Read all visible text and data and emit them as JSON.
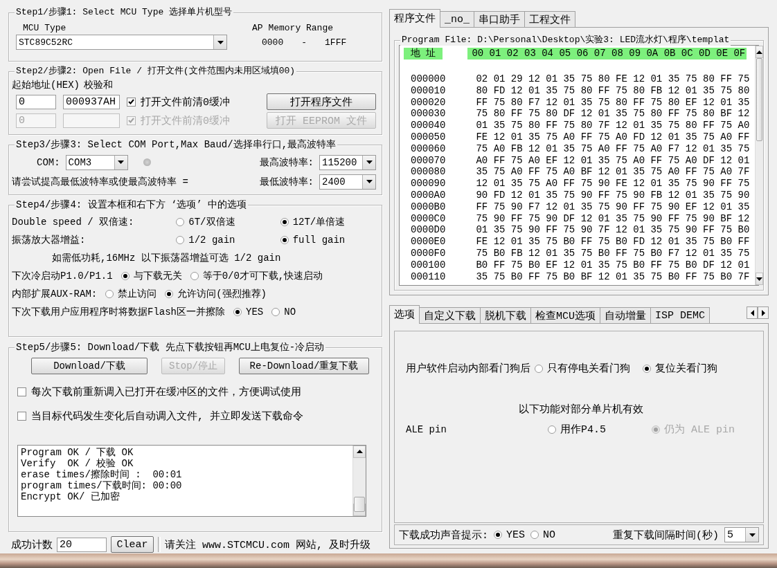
{
  "step1": {
    "legend": "Step1/步骤1: Select MCU Type  选择单片机型号",
    "mcu_label": "MCU Type",
    "mcu_value": "STC89C52RC",
    "range_label": "AP Memory Range",
    "range_start": "0000",
    "range_separator": "-",
    "range_end": "1FFF"
  },
  "step2": {
    "legend": "Step2/步骤2: Open File / 打开文件(文件范围内未用区域填00)",
    "start_label": "起始地址(HEX)",
    "checksum_label": "校验和",
    "rows": [
      {
        "start": "0",
        "checksum": "000937AH",
        "option": "打开文件前清0缓冲",
        "checked": true,
        "disabled": false,
        "button": "打开程序文件"
      },
      {
        "start": "0",
        "option": "打开文件前清0缓冲",
        "checked": true,
        "disabled": true,
        "button": "打开 EEPROM 文件"
      }
    ]
  },
  "step3": {
    "legend": "Step3/步骤3: Select COM Port,Max Baud/选择串行口,最高波特率",
    "com_label": "COM:",
    "com_value": "COM3",
    "max_label": "最高波特率:",
    "max_value": "115200",
    "hint": "请尝试提高最低波特率或使最高波特率 =",
    "min_label": "最低波特率:",
    "min_value": "2400"
  },
  "step4": {
    "legend": "Step4/步骤4: 设置本框和右下方 ‘选项’ 中的选项",
    "rows": [
      {
        "kind": "choice",
        "label": "Double speed / 双倍速:",
        "choices": [
          {
            "label": "6T/双倍速",
            "selected": false
          },
          {
            "label": "12T/单倍速",
            "selected": true
          }
        ]
      },
      {
        "kind": "choice",
        "label": "振荡放大器增益:",
        "choices": [
          {
            "label": "1/2 gain",
            "selected": false
          },
          {
            "label": "full gain",
            "selected": true
          }
        ]
      },
      {
        "kind": "note",
        "text": "如需低功耗,16MHz 以下振荡器增益可选 1/2 gain"
      },
      {
        "kind": "choice",
        "label": "下次冷启动P1.0/P1.1",
        "choices": [
          {
            "label": "与下载无关",
            "selected": true
          },
          {
            "label": "等于0/0才可下载,快速启动",
            "selected": false
          }
        ]
      },
      {
        "kind": "choice",
        "label": "内部扩展AUX-RAM:",
        "choices": [
          {
            "label": "禁止访问",
            "selected": false
          },
          {
            "label": "允许访问(强烈推荐)",
            "selected": true
          }
        ]
      },
      {
        "kind": "choice",
        "label": "下次下载用户应用程序时将数据Flash区一并擦除",
        "choices": [
          {
            "label": "YES",
            "selected": true
          },
          {
            "label": "NO",
            "selected": false
          }
        ]
      }
    ]
  },
  "step5": {
    "legend": "Step5/步骤5: Download/下载  先点下载按钮再MCU上电复位-冷启动",
    "buttons": [
      {
        "label": "Download/下载",
        "disabled": false
      },
      {
        "label": "Stop/停止",
        "disabled": true
      },
      {
        "label": "Re-Download/重复下载",
        "disabled": false
      }
    ],
    "options": [
      {
        "label": "每次下载前重新调入已打开在缓冲区的文件，方便调试使用",
        "checked": false
      },
      {
        "label": "当目标代码发生变化后自动调入文件, 并立即发送下载命令",
        "checked": false
      }
    ],
    "log": [
      "Program OK / 下载 OK",
      "Verify  OK / 校验 OK",
      "erase times/擦除时间 :  00:01",
      "program times/下载时间: 00:00",
      "Encrypt OK/ 已加密"
    ]
  },
  "footer": {
    "count_label": "成功计数",
    "count_value": "20",
    "clear_button": "Clear",
    "notice": "请关注 www.STCMCU.com 网站, 及时升级"
  },
  "top_tabs": [
    {
      "label": "程序文件",
      "selected": true
    },
    {
      "label": "_no_",
      "selected": false
    },
    {
      "label": "串口助手",
      "selected": false
    },
    {
      "label": "工程文件",
      "selected": false
    }
  ],
  "program_file": "Program File: D:\\Personal\\Desktop\\实验3: LED流水灯\\程序\\templat",
  "hex": {
    "address_header": "地 址",
    "columns": "00 01 02 03 04 05 06 07 08 09 0A 0B 0C 0D 0E 0F",
    "rows": [
      {
        "address": "000000",
        "bytes": "02 01 29 12 01 35 75 80 FE 12 01 35 75 80 FF 75"
      },
      {
        "address": "000010",
        "bytes": "80 FD 12 01 35 75 80 FF 75 80 FB 12 01 35 75 80"
      },
      {
        "address": "000020",
        "bytes": "FF 75 80 F7 12 01 35 75 80 FF 75 80 EF 12 01 35"
      },
      {
        "address": "000030",
        "bytes": "75 80 FF 75 80 DF 12 01 35 75 80 FF 75 80 BF 12"
      },
      {
        "address": "000040",
        "bytes": "01 35 75 80 FF 75 80 7F 12 01 35 75 80 FF 75 A0"
      },
      {
        "address": "000050",
        "bytes": "FE 12 01 35 75 A0 FF 75 A0 FD 12 01 35 75 A0 FF"
      },
      {
        "address": "000060",
        "bytes": "75 A0 FB 12 01 35 75 A0 FF 75 A0 F7 12 01 35 75"
      },
      {
        "address": "000070",
        "bytes": "A0 FF 75 A0 EF 12 01 35 75 A0 FF 75 A0 DF 12 01"
      },
      {
        "address": "000080",
        "bytes": "35 75 A0 FF 75 A0 BF 12 01 35 75 A0 FF 75 A0 7F"
      },
      {
        "address": "000090",
        "bytes": "12 01 35 75 A0 FF 75 90 FE 12 01 35 75 90 FF 75"
      },
      {
        "address": "0000A0",
        "bytes": "90 FD 12 01 35 75 90 FF 75 90 FB 12 01 35 75 90"
      },
      {
        "address": "0000B0",
        "bytes": "FF 75 90 F7 12 01 35 75 90 FF 75 90 EF 12 01 35"
      },
      {
        "address": "0000C0",
        "bytes": "75 90 FF 75 90 DF 12 01 35 75 90 FF 75 90 BF 12"
      },
      {
        "address": "0000D0",
        "bytes": "01 35 75 90 FF 75 90 7F 12 01 35 75 90 FF 75 B0"
      },
      {
        "address": "0000E0",
        "bytes": "FE 12 01 35 75 B0 FF 75 B0 FD 12 01 35 75 B0 FF"
      },
      {
        "address": "0000F0",
        "bytes": "75 B0 FB 12 01 35 75 B0 FF 75 B0 F7 12 01 35 75"
      },
      {
        "address": "000100",
        "bytes": "B0 FF 75 B0 EF 12 01 35 75 B0 FF 75 B0 DF 12 01"
      },
      {
        "address": "000110",
        "bytes": "35 75 B0 FF 75 B0 BF 12 01 35 75 B0 FF 75 B0 7F"
      }
    ]
  },
  "bottom_tabs": [
    {
      "label": "选项",
      "selected": true
    },
    {
      "label": "自定义下载",
      "selected": false
    },
    {
      "label": "脱机下载",
      "selected": false
    },
    {
      "label": "检查MCU选项",
      "selected": false
    },
    {
      "label": "自动增量",
      "selected": false
    },
    {
      "label": "ISP DEMC",
      "selected": false
    }
  ],
  "options": {
    "watchdog": {
      "label": "用户软件启动内部看门狗后",
      "choices": [
        {
          "label": "只有停电关看门狗",
          "selected": false
        },
        {
          "label": "复位关看门狗",
          "selected": true
        }
      ]
    },
    "note": "以下功能对部分单片机有效",
    "ale": {
      "label": "ALE pin",
      "choices": [
        {
          "label": "用作P4.5",
          "selected": false,
          "disabled": false
        },
        {
          "label": "仍为 ALE pin",
          "selected": true,
          "disabled": true
        }
      ]
    },
    "sound": {
      "label": "下载成功声音提示:",
      "choices": [
        {
          "label": "YES",
          "selected": true
        },
        {
          "label": "NO",
          "selected": false
        }
      ]
    },
    "interval": {
      "label": "重复下载间隔时间(秒)",
      "value": "5"
    }
  }
}
